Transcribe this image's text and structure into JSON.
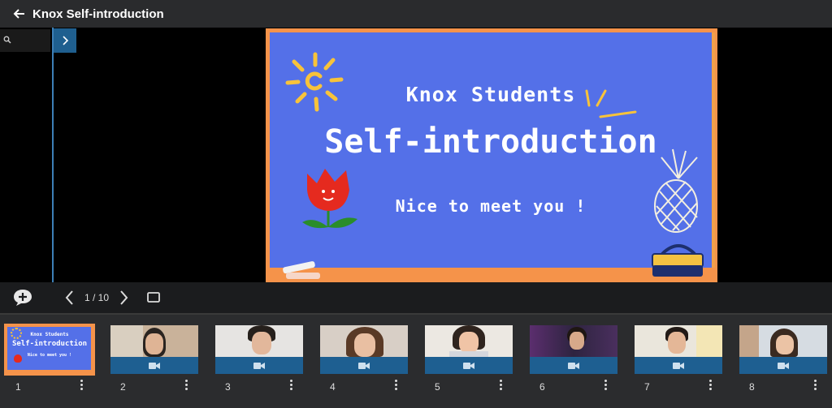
{
  "window": {
    "title": "Knox Self-introduction"
  },
  "slide": {
    "line1": "Knox Students",
    "line2": "Self-introduction",
    "line3": "Nice to meet you !"
  },
  "controls": {
    "page_indicator": "1 / 10"
  },
  "filmstrip": {
    "thumbs": [
      {
        "num": "1"
      },
      {
        "num": "2"
      },
      {
        "num": "3"
      },
      {
        "num": "4"
      },
      {
        "num": "5"
      },
      {
        "num": "6"
      },
      {
        "num": "7"
      },
      {
        "num": "8"
      }
    ],
    "thumb1_title_small": "Knox Students",
    "thumb1_title_big": "Self-introduction",
    "thumb1_sub": "Nice to meet you !"
  },
  "colors": {
    "accent": "#1e5f91",
    "slide_bg": "#5470e8",
    "slide_border": "#f5934a"
  },
  "icons": [
    "back-arrow-icon",
    "search-icon",
    "chevron-right-icon",
    "add-comment-icon",
    "chevron-left-icon",
    "fullscreen-icon",
    "video-camera-icon",
    "more-vert-icon"
  ]
}
